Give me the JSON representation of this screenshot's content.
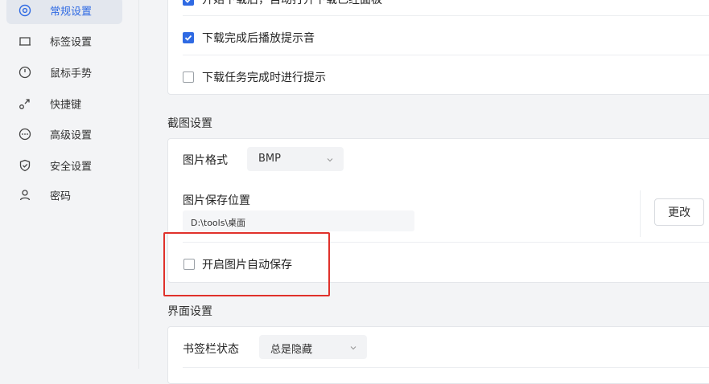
{
  "sidebar": {
    "items": [
      {
        "label": "常规设置",
        "icon": "general-settings-icon",
        "active": true
      },
      {
        "label": "标签设置",
        "icon": "tab-icon"
      },
      {
        "label": "鼠标手势",
        "icon": "mouse-icon"
      },
      {
        "label": "快捷键",
        "icon": "shortcut-icon"
      },
      {
        "label": "高级设置",
        "icon": "more-icon"
      },
      {
        "label": "安全设置",
        "icon": "shield-icon"
      },
      {
        "label": "密码",
        "icon": "user-icon"
      }
    ]
  },
  "download": {
    "top_partial_label": "开始下载后，自动打开下载已经面板",
    "option_sound": "下载完成后播放提示音",
    "option_sound_checked": true,
    "option_notify": "下载任务完成时进行提示",
    "option_notify_checked": false
  },
  "screenshot": {
    "title": "截图设置",
    "format_label": "图片格式",
    "format_value": "BMP",
    "save_location_label": "图片保存位置",
    "save_path": "D:\\tools\\桌面",
    "change_button": "更改",
    "auto_save_label": "开启图片自动保存",
    "auto_save_checked": false
  },
  "interface": {
    "title": "界面设置",
    "bookmark_bar_label": "书签栏状态",
    "bookmark_bar_value": "总是隐藏"
  },
  "colors": {
    "accent": "#2f6ae3",
    "highlight_box": "#e0312b"
  }
}
